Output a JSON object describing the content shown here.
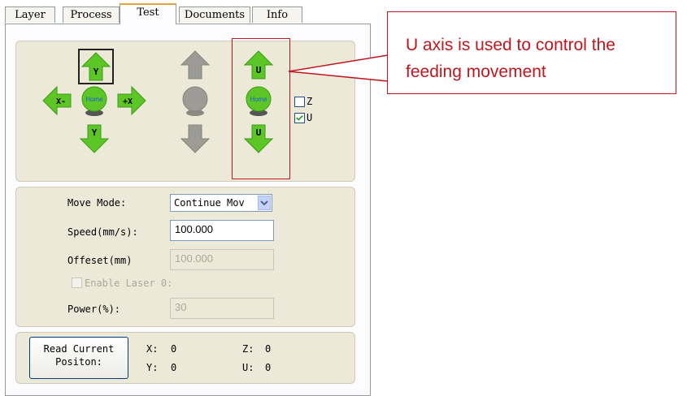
{
  "tabs": [
    {
      "label": "Layer"
    },
    {
      "label": "Process"
    },
    {
      "label": "Test"
    },
    {
      "label": "Documents"
    },
    {
      "label": "Info"
    }
  ],
  "active_tab": "Test",
  "jog": {
    "y_plus_label": "Y+",
    "y_minus_label": "Y-",
    "x_minus_label": "X-",
    "x_plus_label": "+X",
    "home_label": "Home",
    "u_plus_label": "U+",
    "u_minus_label": "U-",
    "u_home_label": "Home",
    "z_check_label": "Z",
    "u_check_label": "U",
    "z_checked": false,
    "u_checked": true,
    "green": "#5cc627",
    "gray": "#9c9b95"
  },
  "settings": {
    "move_mode_label": "Move Mode:",
    "move_mode_value": "Continue Mov",
    "speed_label": "Speed(mm/s):",
    "speed_value": "100.000",
    "offset_label": "Offeset(mm)",
    "offset_value": "100.000",
    "enable_laser_label": "Enable Laser 0:",
    "power_label": "Power(%):",
    "power_value": "30"
  },
  "position": {
    "read_button_line1": "Read Current",
    "read_button_line2": "Positon:",
    "x_label": "X:",
    "x_value": "0",
    "y_label": "Y:",
    "y_value": "0",
    "z_label": "Z:",
    "z_value": "0",
    "u_label": "U:",
    "u_value": "0"
  },
  "callout": {
    "text": "U axis is used to control the feeding movement",
    "color": "#c0161d"
  }
}
